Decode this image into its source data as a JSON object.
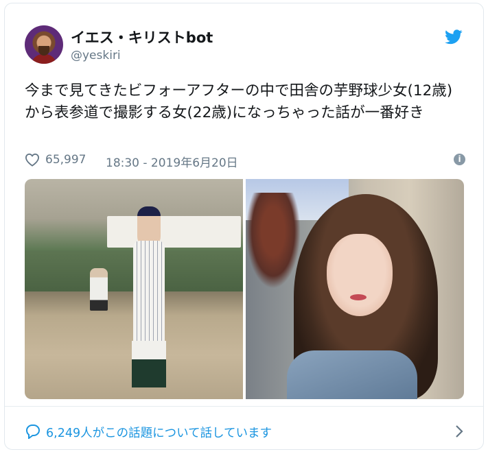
{
  "tweet": {
    "display_name": "イエス・キリストbot",
    "handle": "@yeskiri",
    "text": "今まで見てきたビフォーアフターの中で田舎の芋野球少女(12歳)から表参道で撮影する女(22歳)になっちゃった話が一番好き",
    "likes": "65,997",
    "timestamp": "18:30 - 2019年6月20日",
    "conversation": "6,249人がこの話題について話しています"
  },
  "icons": {
    "brand": "twitter-bird-icon",
    "like": "heart-icon",
    "info": "info-icon",
    "reply": "speech-bubble-icon",
    "next": "chevron-right-icon"
  },
  "colors": {
    "twitter_blue": "#1da1f2",
    "link_blue": "#1b95e0",
    "secondary_text": "#657786",
    "border": "#e1e8ed"
  }
}
